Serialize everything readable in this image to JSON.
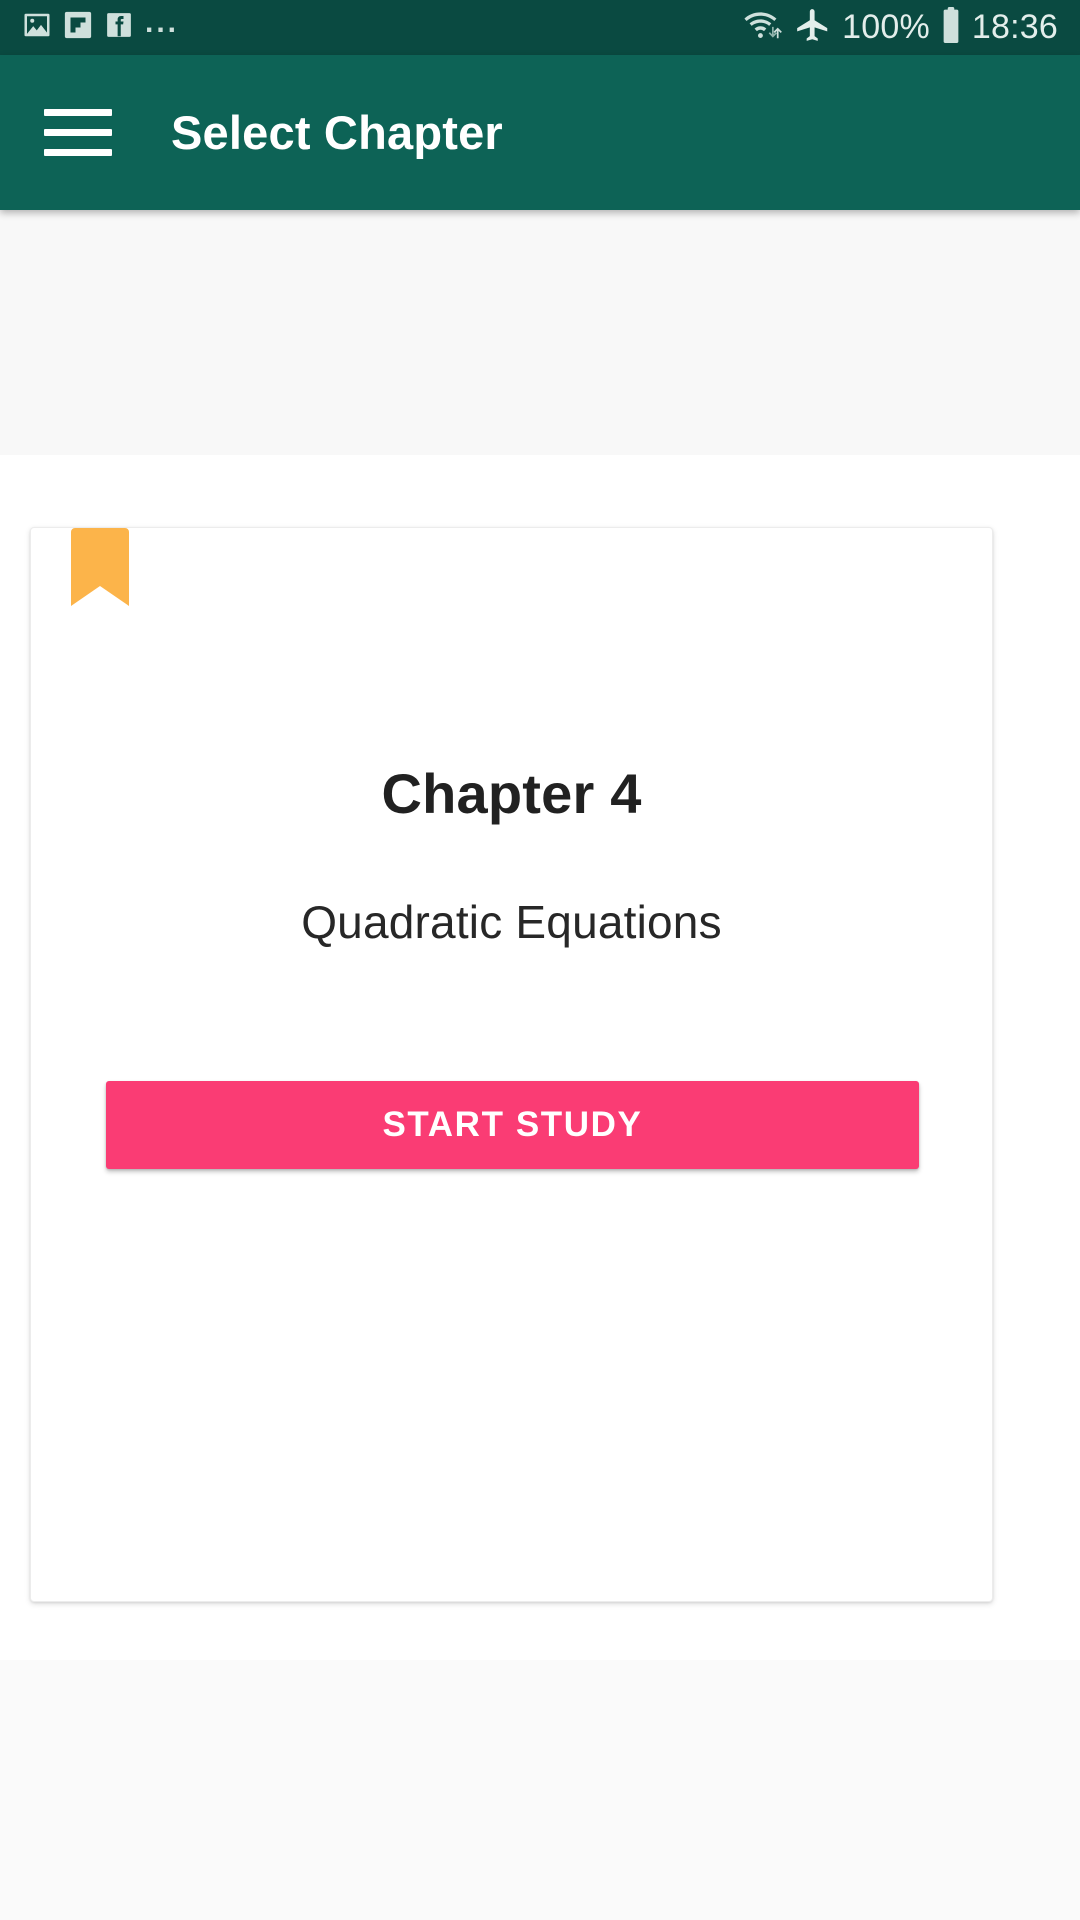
{
  "status_bar": {
    "background_color": "#0A4A41",
    "notification_icons": [
      "gallery-icon",
      "flipboard-icon",
      "facebook-icon"
    ],
    "overflow_dots": "...",
    "battery_percent": "100%",
    "time": "18:36",
    "right_icons": [
      "wifi-icon",
      "airplane-mode-icon",
      "battery-icon"
    ]
  },
  "app_bar": {
    "background_color": "#0D6356",
    "menu_icon": "hamburger-menu-icon",
    "title": "Select Chapter"
  },
  "card": {
    "bookmark_icon": "bookmark-ribbon-icon",
    "bookmark_color": "#FCB44A",
    "title": "Chapter 4",
    "subtitle": "Quadratic Equations",
    "button_label": "START STUDY",
    "button_color": "#FA3C74"
  }
}
